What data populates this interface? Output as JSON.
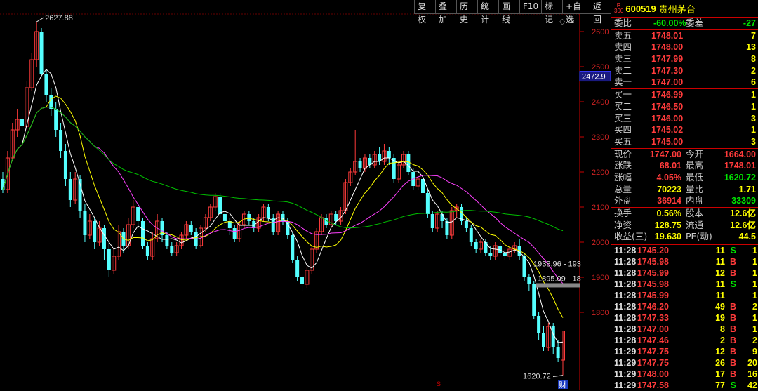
{
  "toolbar": [
    "复权",
    "叠加",
    "历史",
    "统计",
    "画线",
    "F10",
    "标记",
    "+自选",
    "返回"
  ],
  "header": {
    "badge_top": "R",
    "badge_bottom": "300",
    "code": "600519",
    "name": "贵州茅台"
  },
  "axis_ticks": [
    "2600",
    "2500",
    "2400",
    "2300",
    "2200",
    "2100",
    "2000",
    "1900",
    "1800"
  ],
  "axis_current": "2472.9",
  "annotations": {
    "high": "2627.88",
    "low": "1620.72",
    "level1": "1938.96 - 193",
    "level2": "1895.09 - 18",
    "cai": "财"
  },
  "weibi": {
    "label1": "委比",
    "value1": "-60.00%",
    "label2": "委差",
    "value2": "-27"
  },
  "asks": [
    {
      "label": "卖五",
      "price": "1748.01",
      "vol": "7"
    },
    {
      "label": "卖四",
      "price": "1748.00",
      "vol": "13"
    },
    {
      "label": "卖三",
      "price": "1747.99",
      "vol": "8"
    },
    {
      "label": "卖二",
      "price": "1747.30",
      "vol": "2"
    },
    {
      "label": "卖一",
      "price": "1747.00",
      "vol": "6"
    }
  ],
  "bids": [
    {
      "label": "买一",
      "price": "1746.99",
      "vol": "1"
    },
    {
      "label": "买二",
      "price": "1746.50",
      "vol": "1"
    },
    {
      "label": "买三",
      "price": "1746.00",
      "vol": "3"
    },
    {
      "label": "买四",
      "price": "1745.02",
      "vol": "1"
    },
    {
      "label": "买五",
      "price": "1745.00",
      "vol": "3"
    }
  ],
  "quote": [
    {
      "l1": "现价",
      "v1": "1747.00",
      "l2": "今开",
      "v2": "1664.00"
    },
    {
      "l1": "涨跌",
      "v1": "68.01",
      "l2": "最高",
      "v2": "1748.01"
    },
    {
      "l1": "涨幅",
      "v1": "4.05%",
      "l2": "最低",
      "v2": "1620.72"
    },
    {
      "l1": "总量",
      "v1": "70223",
      "l2": "量比",
      "v2": "1.71"
    },
    {
      "l1": "外盘",
      "v1": "36914",
      "l2": "内盘",
      "v2": "33309"
    }
  ],
  "stats": [
    {
      "l1": "换手",
      "v1": "0.56%",
      "l2": "股本",
      "v2": "12.6亿"
    },
    {
      "l1": "净资",
      "v1": "128.75",
      "l2": "流通",
      "v2": "12.6亿"
    },
    {
      "l1": "收益(三)",
      "v1": "19.630",
      "l2": "PE(动)",
      "v2": "44.5"
    }
  ],
  "trades": [
    {
      "time": "11:28",
      "price": "1745.20",
      "vol": "11",
      "side": "S",
      "extra": "1"
    },
    {
      "time": "11:28",
      "price": "1745.98",
      "vol": "11",
      "side": "B",
      "extra": "1"
    },
    {
      "time": "11:28",
      "price": "1745.99",
      "vol": "12",
      "side": "B",
      "extra": "1"
    },
    {
      "time": "11:28",
      "price": "1745.98",
      "vol": "11",
      "side": "S",
      "extra": "1"
    },
    {
      "time": "11:28",
      "price": "1745.99",
      "vol": "11",
      "side": "",
      "extra": "1"
    },
    {
      "time": "11:28",
      "price": "1746.20",
      "vol": "49",
      "side": "B",
      "extra": "2"
    },
    {
      "time": "11:28",
      "price": "1747.33",
      "vol": "19",
      "side": "B",
      "extra": "1"
    },
    {
      "time": "11:28",
      "price": "1747.00",
      "vol": "8",
      "side": "B",
      "extra": "1"
    },
    {
      "time": "11:28",
      "price": "1747.46",
      "vol": "2",
      "side": "B",
      "extra": "2"
    },
    {
      "time": "11:29",
      "price": "1747.75",
      "vol": "12",
      "side": "B",
      "extra": "9"
    },
    {
      "time": "11:29",
      "price": "1747.75",
      "vol": "26",
      "side": "B",
      "extra": "20"
    },
    {
      "time": "11:29",
      "price": "1748.00",
      "vol": "17",
      "side": "B",
      "extra": "16"
    },
    {
      "time": "11:29",
      "price": "1747.58",
      "vol": "77",
      "side": "S",
      "extra": "42"
    }
  ],
  "chart_data": {
    "type": "candlestick",
    "ylim": [
      1600,
      2650
    ],
    "ticks": [
      1800,
      1900,
      2000,
      2100,
      2200,
      2300,
      2400,
      2500,
      2600
    ],
    "candles": [
      [
        2180,
        2150,
        2200,
        2140
      ],
      [
        2150,
        2240,
        2260,
        2140
      ],
      [
        2240,
        2320,
        2340,
        2230
      ],
      [
        2320,
        2350,
        2380,
        2300
      ],
      [
        2350,
        2330,
        2370,
        2310
      ],
      [
        2330,
        2440,
        2460,
        2320
      ],
      [
        2440,
        2520,
        2540,
        2430
      ],
      [
        2520,
        2600,
        2627.88,
        2500
      ],
      [
        2600,
        2480,
        2610,
        2470
      ],
      [
        2480,
        2420,
        2490,
        2400
      ],
      [
        2420,
        2380,
        2440,
        2360
      ],
      [
        2380,
        2320,
        2400,
        2300
      ],
      [
        2320,
        2260,
        2340,
        2240
      ],
      [
        2260,
        2180,
        2280,
        2160
      ],
      [
        2180,
        2120,
        2200,
        2100
      ],
      [
        2120,
        2180,
        2200,
        2110
      ],
      [
        2180,
        2090,
        2190,
        2070
      ],
      [
        2090,
        2020,
        2110,
        2000
      ],
      [
        2020,
        2060,
        2080,
        2010
      ],
      [
        2060,
        2000,
        2070,
        1980
      ],
      [
        2000,
        2040,
        2060,
        1990
      ],
      [
        2040,
        1980,
        2050,
        1950
      ],
      [
        1980,
        1920,
        2000,
        1900
      ],
      [
        1920,
        1960,
        1980,
        1910
      ],
      [
        1960,
        2030,
        2050,
        1950
      ],
      [
        2030,
        1990,
        2040,
        1970
      ],
      [
        1990,
        2050,
        2070,
        1980
      ],
      [
        2050,
        2100,
        2120,
        2040
      ],
      [
        2100,
        2060,
        2110,
        2040
      ],
      [
        2060,
        1990,
        2070,
        1980
      ],
      [
        1990,
        1960,
        2000,
        1950
      ],
      [
        1960,
        2010,
        2030,
        1950
      ],
      [
        2010,
        2060,
        2080,
        2000
      ],
      [
        2060,
        2020,
        2070,
        2000
      ],
      [
        2020,
        1990,
        2030,
        1980
      ],
      [
        1990,
        1970,
        2000,
        1960
      ],
      [
        1970,
        1990,
        2000,
        1960
      ],
      [
        1990,
        2020,
        2030,
        1980
      ],
      [
        2020,
        2050,
        2060,
        2010
      ],
      [
        2050,
        2030,
        2060,
        2020
      ],
      [
        2030,
        1990,
        2040,
        1980
      ],
      [
        1990,
        2040,
        2050,
        1985
      ],
      [
        2040,
        2070,
        2080,
        2030
      ],
      [
        2070,
        2100,
        2110,
        2060
      ],
      [
        2100,
        2130,
        2140,
        2090
      ],
      [
        2130,
        2080,
        2140,
        2070
      ],
      [
        2080,
        2060,
        2090,
        2050
      ],
      [
        2060,
        2040,
        2070,
        2020
      ],
      [
        2040,
        2010,
        2050,
        2000
      ],
      [
        2010,
        2050,
        2060,
        2000
      ],
      [
        2050,
        2080,
        2090,
        2040
      ],
      [
        2080,
        2060,
        2090,
        2050
      ],
      [
        2060,
        2040,
        2070,
        2030
      ],
      [
        2040,
        2070,
        2080,
        2030
      ],
      [
        2070,
        2100,
        2110,
        2060
      ],
      [
        2100,
        2070,
        2110,
        2060
      ],
      [
        2070,
        2030,
        2080,
        2020
      ],
      [
        2030,
        2080,
        2090,
        2020
      ],
      [
        2080,
        2060,
        2090,
        2050
      ],
      [
        2060,
        2020,
        2070,
        2010
      ],
      [
        2020,
        1950,
        2030,
        1940
      ],
      [
        1950,
        1900,
        1960,
        1890
      ],
      [
        1900,
        1880,
        1910,
        1860
      ],
      [
        1880,
        1920,
        1930,
        1870
      ],
      [
        1920,
        1980,
        1990,
        1910
      ],
      [
        1980,
        2030,
        2040,
        1970
      ],
      [
        2030,
        2070,
        2080,
        2020
      ],
      [
        2070,
        2050,
        2080,
        2040
      ],
      [
        2050,
        2080,
        2090,
        2040
      ],
      [
        2080,
        2060,
        2090,
        2050
      ],
      [
        2060,
        2090,
        2100,
        2050
      ],
      [
        2090,
        2170,
        2180,
        2080
      ],
      [
        2170,
        2200,
        2210,
        2160
      ],
      [
        2200,
        2230,
        2320,
        2190
      ],
      [
        2230,
        2210,
        2240,
        2200
      ],
      [
        2210,
        2240,
        2250,
        2200
      ],
      [
        2240,
        2220,
        2250,
        2210
      ],
      [
        2220,
        2250,
        2260,
        2210
      ],
      [
        2250,
        2230,
        2270,
        2220
      ],
      [
        2230,
        2260,
        2280,
        2220
      ],
      [
        2260,
        2240,
        2270,
        2220
      ],
      [
        2240,
        2180,
        2250,
        2170
      ],
      [
        2180,
        2220,
        2230,
        2170
      ],
      [
        2220,
        2250,
        2260,
        2210
      ],
      [
        2250,
        2200,
        2260,
        2190
      ],
      [
        2200,
        2160,
        2210,
        2150
      ],
      [
        2160,
        2180,
        2190,
        2150
      ],
      [
        2180,
        2140,
        2190,
        2130
      ],
      [
        2140,
        2080,
        2150,
        2070
      ],
      [
        2080,
        2040,
        2090,
        2030
      ],
      [
        2040,
        2080,
        2090,
        2030
      ],
      [
        2080,
        2060,
        2090,
        2040
      ],
      [
        2060,
        2020,
        2070,
        2010
      ],
      [
        2020,
        2090,
        2100,
        2010
      ],
      [
        2090,
        2100,
        2110,
        2070
      ],
      [
        2100,
        2060,
        2110,
        2050
      ],
      [
        2060,
        2040,
        2070,
        2030
      ],
      [
        2040,
        2000,
        2050,
        1990
      ],
      [
        2000,
        1980,
        2010,
        1970
      ],
      [
        1980,
        2000,
        2010,
        1970
      ],
      [
        2000,
        1970,
        2010,
        1960
      ],
      [
        1970,
        1960,
        1990,
        1950
      ],
      [
        1960,
        1990,
        2000,
        1950
      ],
      [
        1990,
        1970,
        2000,
        1960
      ],
      [
        1970,
        1960,
        1980,
        1950
      ],
      [
        1960,
        1980,
        1990,
        1950
      ],
      [
        1980,
        1990,
        2000,
        1970
      ],
      [
        1990,
        1960,
        2010,
        1950
      ],
      [
        1960,
        1900,
        1970,
        1890
      ],
      [
        1900,
        1880,
        1910,
        1860
      ],
      [
        1880,
        1790,
        1890,
        1780
      ],
      [
        1790,
        1740,
        1800,
        1720
      ],
      [
        1740,
        1700,
        1760,
        1690
      ],
      [
        1700,
        1760,
        1770,
        1690
      ],
      [
        1760,
        1700,
        1770,
        1680
      ],
      [
        1700,
        1670,
        1720,
        1660
      ],
      [
        1664,
        1747,
        1748.01,
        1620.72
      ]
    ]
  }
}
